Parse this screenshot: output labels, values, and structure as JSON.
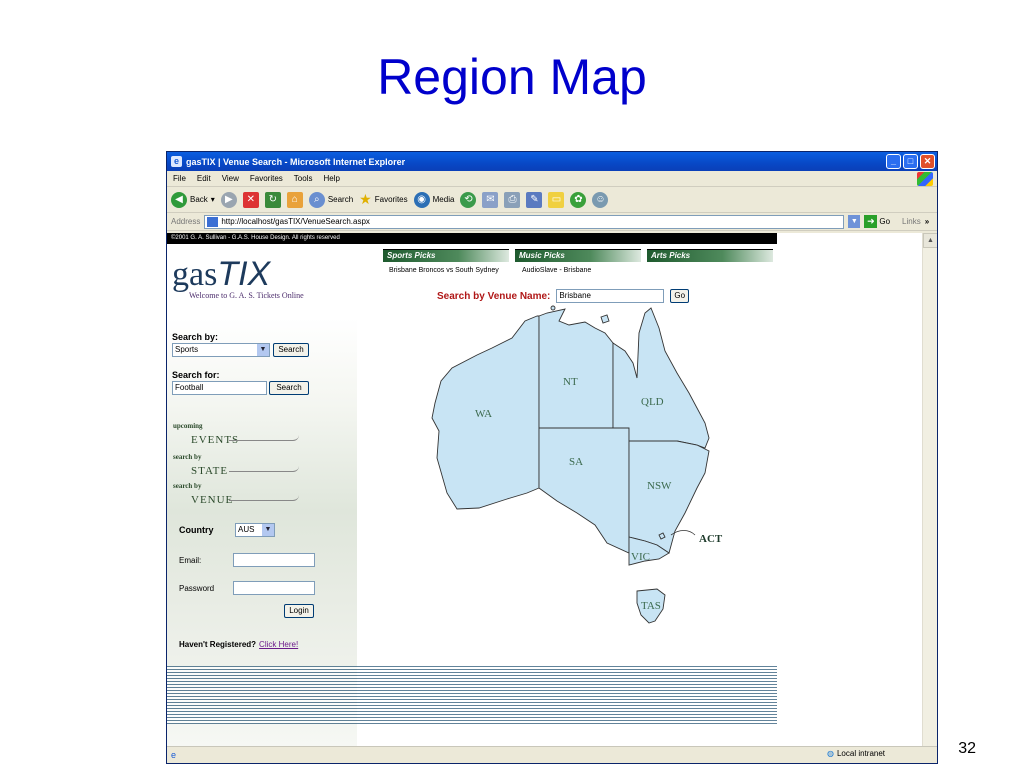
{
  "slide": {
    "title": "Region Map",
    "number": "32"
  },
  "window": {
    "title": "gasTIX | Venue Search - Microsoft Internet Explorer",
    "menu": [
      "File",
      "Edit",
      "View",
      "Favorites",
      "Tools",
      "Help"
    ],
    "toolbar": {
      "back": "Back",
      "search": "Search",
      "favorites": "Favorites",
      "media": "Media"
    },
    "address_label": "Address",
    "address_value": "http://localhost/gasTIX/VenueSearch.aspx",
    "go_label": "Go",
    "links_label": "Links"
  },
  "page": {
    "copyright": "©2001 G. A. Sullivan - G.A.S. House Design. All rights reserved",
    "logo_plain": "gas",
    "logo_italic": "TIX",
    "logo_tagline": "Welcome to G. A. S. Tickets Online",
    "search_by_label": "Search by:",
    "search_by_value": "Sports",
    "search_button": "Search",
    "search_for_label": "Search for:",
    "search_for_value": "Football",
    "search_for_button": "Search",
    "nav": [
      {
        "small": "upcoming",
        "big": "EVENTS"
      },
      {
        "small": "search by",
        "big": "STATE"
      },
      {
        "small": "search by",
        "big": "VENUE"
      }
    ],
    "country_label": "Country",
    "country_value": "AUS",
    "email_label": "Email:",
    "password_label": "Password",
    "login_button": "Login",
    "registered_q": "Haven't Registered?",
    "registered_link": "Click Here!",
    "tabs": [
      {
        "label": "Sports Picks",
        "pick": "Brisbane Broncos vs South Sydney"
      },
      {
        "label": "Music Picks",
        "pick": "AudioSlave - Brisbane"
      },
      {
        "label": "Arts Picks",
        "pick": ""
      }
    ],
    "venue_label": "Search by Venue Name:",
    "venue_value": "Brisbane",
    "venue_go": "Go",
    "map_regions": [
      "WA",
      "NT",
      "SA",
      "QLD",
      "NSW",
      "VIC",
      "TAS",
      "ACT"
    ],
    "map_colors": {
      "fill": "#c8e4f4",
      "stroke": "#333333",
      "label": "#3c6a4e"
    }
  },
  "status": {
    "zone": "Local intranet"
  }
}
